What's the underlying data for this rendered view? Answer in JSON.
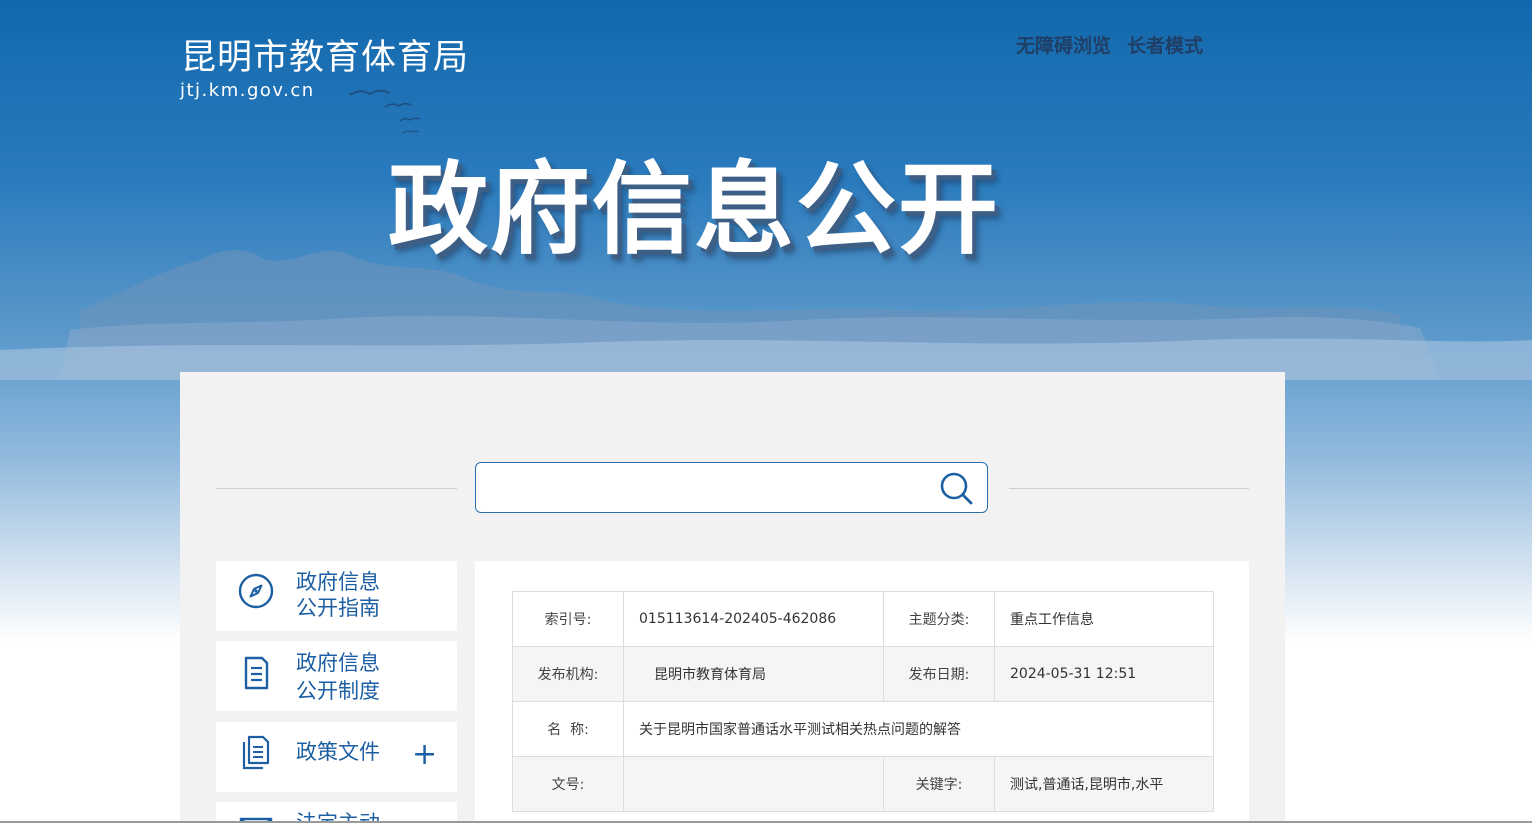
{
  "header": {
    "site_name": "昆明市教育体育局",
    "site_domain": "jtj.km.gov.cn",
    "links": [
      "无障碍浏览",
      "长者模式"
    ]
  },
  "banner": {
    "title": "政府信息公开"
  },
  "search": {
    "value": "",
    "icon": "search-icon"
  },
  "sidebar": {
    "items": [
      {
        "line1": "政府信息",
        "line2": "公开指南",
        "icon": "compass-icon"
      },
      {
        "line1": "政府信息",
        "line2": "公开制度",
        "icon": "document-icon"
      },
      {
        "line1": "政策文件",
        "expand": "+",
        "icon": "files-icon"
      },
      {
        "line1": "法定主动",
        "icon": "mail-icon"
      }
    ]
  },
  "meta": {
    "index_label": "索引号:",
    "index_value": "015113614-202405-462086",
    "topic_label": "主题分类:",
    "topic_value": "重点工作信息",
    "org_label": "发布机构:",
    "org_value": "昆明市教育体育局",
    "date_label": "发布日期:",
    "date_value": "2024-05-31 12:51",
    "name_label": "名  称:",
    "name_value": "关于昆明市国家普通话水平测试相关热点问题的解答",
    "docno_label": "文号:",
    "docno_value": "",
    "keywords_label": "关键字:",
    "keywords_value": "测试,普通话,昆明市,水平"
  },
  "colors": {
    "primary": "#1d5fa3",
    "banner_top": "#1268ad",
    "panel_bg": "#f2f2f2"
  }
}
